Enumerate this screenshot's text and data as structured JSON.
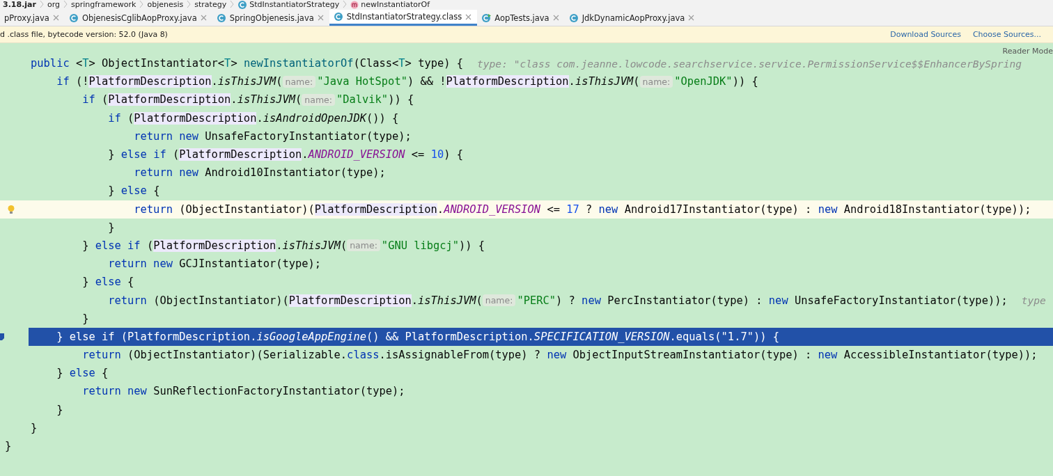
{
  "breadcrumb": [
    {
      "text": "3.18.jar",
      "kind": "jar"
    },
    {
      "text": "org",
      "kind": "package"
    },
    {
      "text": "springframework",
      "kind": "package"
    },
    {
      "text": "objenesis",
      "kind": "package"
    },
    {
      "text": "strategy",
      "kind": "package"
    },
    {
      "text": "StdInstantiatorStrategy",
      "kind": "class"
    },
    {
      "text": "newInstantiatorOf",
      "kind": "method"
    }
  ],
  "tabs": [
    {
      "label": "pProxy.java",
      "kind": "none",
      "selected": false
    },
    {
      "label": "ObjenesisCglibAopProxy.java",
      "kind": "class",
      "selected": false
    },
    {
      "label": "SpringObjenesis.java",
      "kind": "class",
      "selected": false
    },
    {
      "label": "StdInstantiatorStrategy.class",
      "kind": "class",
      "selected": true
    },
    {
      "label": "AopTests.java",
      "kind": "test",
      "selected": false
    },
    {
      "label": "JdkDynamicAopProxy.java",
      "kind": "class",
      "selected": false
    }
  ],
  "notice": {
    "text": "d .class file, bytecode version: 52.0 (Java 8)",
    "links": [
      "Download Sources",
      "Choose Sources..."
    ]
  },
  "reader_mode": "Reader Mode",
  "code_lines": [
    {
      "caret": false,
      "selected": false,
      "tokens": [
        {
          "kind": "kw",
          "text": "public"
        },
        {
          "kind": "p",
          "text": " <"
        },
        {
          "kind": "tp",
          "text": "T"
        },
        {
          "kind": "p",
          "text": "> ObjectInstantiator<"
        },
        {
          "kind": "tp",
          "text": "T"
        },
        {
          "kind": "p",
          "text": "> "
        },
        {
          "kind": "decl",
          "text": "newInstantiatorOf"
        },
        {
          "kind": "p",
          "text": "(Class<"
        },
        {
          "kind": "tp",
          "text": "T"
        },
        {
          "kind": "p",
          "text": "> type) {"
        },
        {
          "kind": "inline",
          "text": "type: \"class com.jeanne.lowcode.searchservice.service.PermissionService$$EnhancerBySpring"
        }
      ],
      "children": [
        {
          "caret": false,
          "selected": false,
          "tokens": [
            {
              "kind": "kw",
              "text": "if"
            },
            {
              "kind": "p",
              "text": " (!"
            },
            {
              "kind": "ref",
              "text": "PlatformDescription"
            },
            {
              "kind": "p",
              "text": "."
            },
            {
              "kind": "st",
              "text": "isThisJVM"
            },
            {
              "kind": "p",
              "text": "("
            },
            {
              "kind": "hint",
              "text": "name:"
            },
            {
              "kind": "str",
              "text": "\"Java HotSpot\""
            },
            {
              "kind": "p",
              "text": ") && !"
            },
            {
              "kind": "ref",
              "text": "PlatformDescription"
            },
            {
              "kind": "p",
              "text": "."
            },
            {
              "kind": "st",
              "text": "isThisJVM"
            },
            {
              "kind": "p",
              "text": "("
            },
            {
              "kind": "hint",
              "text": "name:"
            },
            {
              "kind": "str",
              "text": "\"OpenJDK\""
            },
            {
              "kind": "p",
              "text": ")) {"
            }
          ],
          "children": [
            {
              "caret": false,
              "selected": false,
              "tokens": [
                {
                  "kind": "kw",
                  "text": "if"
                },
                {
                  "kind": "p",
                  "text": " ("
                },
                {
                  "kind": "ref",
                  "text": "PlatformDescription"
                },
                {
                  "kind": "p",
                  "text": "."
                },
                {
                  "kind": "st",
                  "text": "isThisJVM"
                },
                {
                  "kind": "p",
                  "text": "("
                },
                {
                  "kind": "hint",
                  "text": "name:"
                },
                {
                  "kind": "str",
                  "text": "\"Dalvik\""
                },
                {
                  "kind": "p",
                  "text": ")) {"
                }
              ],
              "children": [
                {
                  "caret": false,
                  "selected": false,
                  "tokens": [
                    {
                      "kind": "kw",
                      "text": "if"
                    },
                    {
                      "kind": "p",
                      "text": " ("
                    },
                    {
                      "kind": "ref",
                      "text": "PlatformDescription"
                    },
                    {
                      "kind": "p",
                      "text": "."
                    },
                    {
                      "kind": "st",
                      "text": "isAndroidOpenJDK"
                    },
                    {
                      "kind": "p",
                      "text": "()) {"
                    }
                  ],
                  "children": [
                    {
                      "caret": false,
                      "selected": false,
                      "tokens": [
                        {
                          "kind": "kw",
                          "text": "return new"
                        },
                        {
                          "kind": "p",
                          "text": " UnsafeFactoryInstantiator(type);"
                        }
                      ]
                    }
                  ]
                },
                {
                  "caret": false,
                  "selected": false,
                  "tokens": [
                    {
                      "kind": "p",
                      "text": "} "
                    },
                    {
                      "kind": "kw",
                      "text": "else if"
                    },
                    {
                      "kind": "p",
                      "text": " ("
                    },
                    {
                      "kind": "ref",
                      "text": "PlatformDescription"
                    },
                    {
                      "kind": "p",
                      "text": "."
                    },
                    {
                      "kind": "const",
                      "text": "ANDROID_VERSION"
                    },
                    {
                      "kind": "p",
                      "text": " <= "
                    },
                    {
                      "kind": "num",
                      "text": "10"
                    },
                    {
                      "kind": "p",
                      "text": ") {"
                    }
                  ],
                  "children": [
                    {
                      "caret": false,
                      "selected": false,
                      "tokens": [
                        {
                          "kind": "kw",
                          "text": "return new"
                        },
                        {
                          "kind": "p",
                          "text": " Android10Instantiator(type);"
                        }
                      ]
                    }
                  ]
                },
                {
                  "caret": false,
                  "selected": false,
                  "tokens": [
                    {
                      "kind": "p",
                      "text": "} "
                    },
                    {
                      "kind": "kw",
                      "text": "else"
                    },
                    {
                      "kind": "p",
                      "text": " {"
                    }
                  ],
                  "children": [
                    {
                      "caret": true,
                      "selected": false,
                      "tokens": [
                        {
                          "kind": "kw",
                          "text": "return"
                        },
                        {
                          "kind": "p",
                          "text": " (ObjectInstantiator)("
                        },
                        {
                          "kind": "ref",
                          "text": "PlatformDescription"
                        },
                        {
                          "kind": "p",
                          "text": "."
                        },
                        {
                          "kind": "const",
                          "text": "ANDROID_VERSION"
                        },
                        {
                          "kind": "p",
                          "text": " <= "
                        },
                        {
                          "kind": "num",
                          "text": "17"
                        },
                        {
                          "kind": "p",
                          "text": " ? "
                        },
                        {
                          "kind": "kw",
                          "text": "new"
                        },
                        {
                          "kind": "p",
                          "text": " Android17Instantiator(type) : "
                        },
                        {
                          "kind": "kw",
                          "text": "new"
                        },
                        {
                          "kind": "p",
                          "text": " Android18Instantiator(type));"
                        }
                      ]
                    }
                  ]
                },
                {
                  "caret": false,
                  "selected": false,
                  "tokens": [
                    {
                      "kind": "p",
                      "text": "}"
                    }
                  ]
                }
              ]
            },
            {
              "caret": false,
              "selected": false,
              "tokens": [
                {
                  "kind": "p",
                  "text": "} "
                },
                {
                  "kind": "kw",
                  "text": "else if"
                },
                {
                  "kind": "p",
                  "text": " ("
                },
                {
                  "kind": "ref",
                  "text": "PlatformDescription"
                },
                {
                  "kind": "p",
                  "text": "."
                },
                {
                  "kind": "st",
                  "text": "isThisJVM"
                },
                {
                  "kind": "p",
                  "text": "("
                },
                {
                  "kind": "hint",
                  "text": "name:"
                },
                {
                  "kind": "str",
                  "text": "\"GNU libgcj\""
                },
                {
                  "kind": "p",
                  "text": ")) {"
                }
              ],
              "children": [
                {
                  "caret": false,
                  "selected": false,
                  "tokens": [
                    {
                      "kind": "kw",
                      "text": "return new"
                    },
                    {
                      "kind": "p",
                      "text": " GCJInstantiator(type);"
                    }
                  ]
                }
              ]
            },
            {
              "caret": false,
              "selected": false,
              "tokens": [
                {
                  "kind": "p",
                  "text": "} "
                },
                {
                  "kind": "kw",
                  "text": "else"
                },
                {
                  "kind": "p",
                  "text": " {"
                }
              ],
              "children": [
                {
                  "caret": false,
                  "selected": false,
                  "tokens": [
                    {
                      "kind": "kw",
                      "text": "return"
                    },
                    {
                      "kind": "p",
                      "text": " (ObjectInstantiator)("
                    },
                    {
                      "kind": "ref",
                      "text": "PlatformDescription"
                    },
                    {
                      "kind": "p",
                      "text": "."
                    },
                    {
                      "kind": "st",
                      "text": "isThisJVM"
                    },
                    {
                      "kind": "p",
                      "text": "("
                    },
                    {
                      "kind": "hint",
                      "text": "name:"
                    },
                    {
                      "kind": "str",
                      "text": "\"PERC\""
                    },
                    {
                      "kind": "p",
                      "text": ") ? "
                    },
                    {
                      "kind": "kw",
                      "text": "new"
                    },
                    {
                      "kind": "p",
                      "text": " PercInstantiator(type) : "
                    },
                    {
                      "kind": "kw",
                      "text": "new"
                    },
                    {
                      "kind": "p",
                      "text": " UnsafeFactoryInstantiator(type));"
                    },
                    {
                      "kind": "inline",
                      "text": "type"
                    }
                  ]
                }
              ]
            },
            {
              "caret": false,
              "selected": false,
              "tokens": [
                {
                  "kind": "p",
                  "text": "}"
                }
              ]
            }
          ]
        },
        {
          "caret": false,
          "selected": true,
          "tokens": [
            {
              "kind": "p",
              "text": "} "
            },
            {
              "kind": "kw",
              "text": "else if"
            },
            {
              "kind": "p",
              "text": " (PlatformDescription."
            },
            {
              "kind": "st",
              "text": "isGoogleAppEngine"
            },
            {
              "kind": "p",
              "text": "() && PlatformDescription."
            },
            {
              "kind": "const",
              "text": "SPECIFICATION_VERSION"
            },
            {
              "kind": "p",
              "text": ".equals("
            },
            {
              "kind": "str",
              "text": "\"1.7\""
            },
            {
              "kind": "p",
              "text": ")) {"
            }
          ],
          "children": [
            {
              "caret": false,
              "selected": false,
              "tokens": [
                {
                  "kind": "kw",
                  "text": "return"
                },
                {
                  "kind": "p",
                  "text": " (ObjectInstantiator)(Serializable."
                },
                {
                  "kind": "kw",
                  "text": "class"
                },
                {
                  "kind": "p",
                  "text": ".isAssignableFrom(type) ? "
                },
                {
                  "kind": "kw",
                  "text": "new"
                },
                {
                  "kind": "p",
                  "text": " ObjectInputStreamInstantiator(type) : "
                },
                {
                  "kind": "kw",
                  "text": "new"
                },
                {
                  "kind": "p",
                  "text": " AccessibleInstantiator(type));"
                }
              ]
            }
          ]
        },
        {
          "caret": false,
          "selected": false,
          "tokens": [
            {
              "kind": "p",
              "text": "} "
            },
            {
              "kind": "kw",
              "text": "else"
            },
            {
              "kind": "p",
              "text": " {"
            }
          ],
          "children": [
            {
              "caret": false,
              "selected": false,
              "tokens": [
                {
                  "kind": "kw",
                  "text": "return new"
                },
                {
                  "kind": "p",
                  "text": " SunReflectionFactoryInstantiator(type);"
                }
              ]
            }
          ]
        },
        {
          "caret": false,
          "selected": false,
          "tokens": [
            {
              "kind": "p",
              "text": "}"
            }
          ]
        }
      ]
    },
    {
      "caret": false,
      "selected": false,
      "tokens": [
        {
          "kind": "p",
          "text": "}"
        }
      ]
    }
  ],
  "closing_line": {
    "tokens": [
      {
        "kind": "p",
        "text": "}"
      }
    ]
  }
}
